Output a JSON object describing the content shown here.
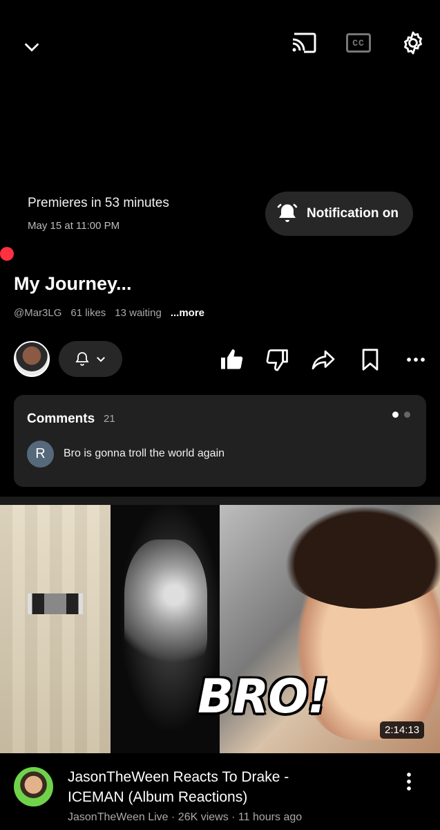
{
  "premiere": {
    "status": "Premieres in 53 minutes",
    "date": "May 15 at 11:00 PM",
    "notify_label": "Notification on"
  },
  "video": {
    "title": "My Journey...",
    "channel_handle": "@Mar3LG",
    "likes": "61 likes",
    "waiting": "13 waiting",
    "more": "...more"
  },
  "comments": {
    "title": "Comments",
    "count": "21",
    "avatar_initial": "R",
    "text": "Bro is gonna troll the world again"
  },
  "next_video": {
    "overlay_text": "BRO!",
    "duration": "2:14:13",
    "title": "JasonTheWeen Reacts To Drake - ICEMAN (Album Reactions)",
    "meta": "JasonTheWeen Live · 26K views · 11 hours ago"
  },
  "icons": [
    "chevron-down-icon",
    "cast-icon",
    "cc-icon",
    "gear-icon",
    "bell-ringing-icon",
    "bell-icon",
    "thumbs-up-icon",
    "thumbs-down-icon",
    "share-icon",
    "bookmark-icon",
    "more-horizontal-icon",
    "more-vertical-icon"
  ],
  "colors": {
    "background": "#000000",
    "surface": "#272727",
    "live_dot": "#ff3040"
  }
}
